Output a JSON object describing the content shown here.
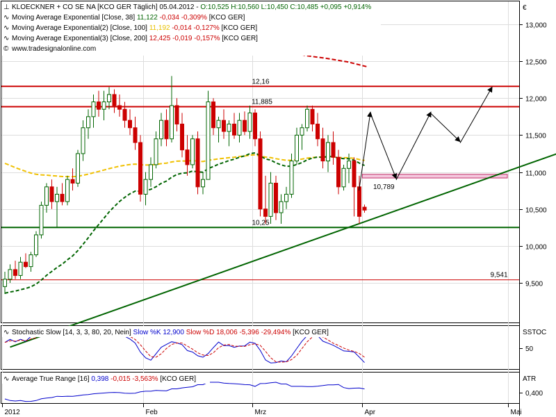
{
  "currency_symbol": "€",
  "legend": {
    "main": {
      "prefix": "KLOECKNER + CO SE NA [KCO GER  Täglich] 05.04.2012 - ",
      "ohlc": "O:10,525 H:10,560 L:10,450 C:10,485",
      "change": "+0,095 +0,914%"
    },
    "ema1": {
      "name": "Moving Average Exponential [Close, 38]",
      "value": "11,122",
      "change": "-0,034 -0,309%",
      "tail": "[KCO GER]"
    },
    "ema2": {
      "name": "Moving Average Exponential(2) [Close, 100]",
      "value": "11,192",
      "change": "-0,014 -0,127%",
      "tail": "[KCO GER]"
    },
    "ema3": {
      "name": "Moving Average Exponential(3) [Close, 200]",
      "value": "12,425",
      "change": "-0,019 -0,157%",
      "tail": "[KCO GER]"
    },
    "watermark": "www.tradesignalonline.com"
  },
  "stochastic": {
    "title": "Stochastic Slow [14, 3, 3, 80, 20, Nein]",
    "k_label": "Slow %K 12,900",
    "d_label": "Slow %D 18,006",
    "change": "-5,396 -29,494%",
    "tail": "[KCO GER]",
    "axis_label": "SSTOC",
    "tick": "50"
  },
  "atr": {
    "title": "Average True Range [16]",
    "value": "0,398",
    "change": "-0,015 -3,563%",
    "tail": "[KCO GER]",
    "axis_label": "ATR",
    "tick": "0,400"
  },
  "chart_data": {
    "type": "candlestick",
    "y_axis_ticks": [
      "13,000",
      "12,500",
      "12,000",
      "11,500",
      "11,000",
      "10,500",
      "10,000",
      "9,500"
    ],
    "x_axis_ticks": [
      "2012",
      "Feb",
      "Mrz",
      "Apr",
      "Mai"
    ],
    "ylim": [
      9.0,
      13.3
    ],
    "levels": [
      {
        "label": "12,16",
        "value": 12.16,
        "color": "#cc0000"
      },
      {
        "label": "11,885",
        "value": 11.885,
        "color": "#cc0000"
      },
      {
        "label": "10,25",
        "value": 10.25,
        "color": "#006400"
      },
      {
        "label": "9,541",
        "value": 9.541,
        "color": "#cc0000"
      }
    ],
    "annotations": [
      {
        "label": "10,789",
        "value": 10.789
      }
    ],
    "resistance_zone": [
      10.92,
      10.97
    ],
    "trendline": [
      {
        "day": 1,
        "value": 8.63
      },
      {
        "day": 120,
        "value": 11.6
      }
    ],
    "projection_path": [
      10.75,
      11.85,
      10.95,
      11.85,
      11.45,
      12.15
    ],
    "candles": [
      [
        0,
        9.45,
        9.65,
        9.35,
        9.55
      ],
      [
        1,
        9.55,
        9.75,
        9.5,
        9.68
      ],
      [
        2,
        9.68,
        9.8,
        9.55,
        9.6
      ],
      [
        3,
        9.6,
        9.85,
        9.55,
        9.78
      ],
      [
        4,
        9.78,
        9.9,
        9.7,
        9.72
      ],
      [
        5,
        9.72,
        9.92,
        9.65,
        9.88
      ],
      [
        6,
        9.88,
        10.2,
        9.85,
        10.15
      ],
      [
        7,
        10.15,
        10.6,
        10.1,
        10.55
      ],
      [
        8,
        10.55,
        10.85,
        10.45,
        10.8
      ],
      [
        9,
        10.8,
        10.9,
        10.5,
        10.6
      ],
      [
        10,
        10.6,
        10.8,
        10.25,
        10.7
      ],
      [
        11,
        10.7,
        10.85,
        10.55,
        10.6
      ],
      [
        12,
        10.6,
        10.95,
        10.55,
        10.9
      ],
      [
        13,
        10.9,
        11.05,
        10.75,
        10.85
      ],
      [
        14,
        10.85,
        11.3,
        10.8,
        11.25
      ],
      [
        15,
        11.25,
        11.7,
        11.15,
        11.6
      ],
      [
        16,
        11.6,
        11.85,
        11.45,
        11.75
      ],
      [
        17,
        11.75,
        12.05,
        11.6,
        11.95
      ],
      [
        18,
        11.95,
        12.1,
        11.75,
        11.85
      ],
      [
        19,
        11.85,
        12.1,
        11.7,
        11.95
      ],
      [
        20,
        11.95,
        12.15,
        11.85,
        12.05
      ],
      [
        21,
        12.05,
        12.12,
        11.8,
        11.9
      ],
      [
        22,
        11.9,
        12.05,
        11.75,
        11.85
      ],
      [
        23,
        11.85,
        11.95,
        11.6,
        11.7
      ],
      [
        24,
        11.7,
        11.85,
        11.5,
        11.6
      ],
      [
        25,
        11.6,
        11.75,
        11.3,
        11.4
      ],
      [
        26,
        11.4,
        11.5,
        10.6,
        10.7
      ],
      [
        27,
        10.7,
        11.0,
        10.55,
        10.9
      ],
      [
        28,
        10.9,
        11.2,
        10.8,
        11.1
      ],
      [
        29,
        11.1,
        11.55,
        11.05,
        11.45
      ],
      [
        30,
        11.45,
        11.8,
        11.35,
        11.7
      ],
      [
        31,
        11.7,
        11.85,
        11.35,
        11.45
      ],
      [
        32,
        11.45,
        12.3,
        11.4,
        11.9
      ],
      [
        33,
        11.9,
        12.0,
        11.55,
        11.65
      ],
      [
        34,
        11.65,
        11.8,
        11.2,
        11.3
      ],
      [
        35,
        11.3,
        11.5,
        10.95,
        11.1
      ],
      [
        36,
        11.1,
        11.5,
        11.05,
        11.45
      ],
      [
        37,
        11.45,
        11.55,
        10.7,
        10.8
      ],
      [
        38,
        10.8,
        11.0,
        10.7,
        10.9
      ],
      [
        39,
        10.9,
        12.1,
        10.9,
        11.95
      ],
      [
        40,
        11.95,
        12.0,
        11.5,
        11.6
      ],
      [
        41,
        11.6,
        11.75,
        11.4,
        11.7
      ],
      [
        42,
        11.7,
        11.85,
        11.45,
        11.55
      ],
      [
        43,
        11.55,
        11.7,
        11.35,
        11.65
      ],
      [
        44,
        11.65,
        11.8,
        11.45,
        11.5
      ],
      [
        45,
        11.5,
        11.8,
        11.4,
        11.7
      ],
      [
        46,
        11.7,
        11.82,
        11.5,
        11.55
      ],
      [
        47,
        11.55,
        11.9,
        11.45,
        11.8
      ],
      [
        48,
        11.8,
        11.85,
        11.35,
        11.45
      ],
      [
        49,
        11.45,
        11.55,
        10.4,
        10.5
      ],
      [
        50,
        10.5,
        10.95,
        10.3,
        10.4
      ],
      [
        51,
        10.4,
        11.0,
        10.3,
        10.85
      ],
      [
        52,
        10.85,
        10.95,
        10.35,
        10.45
      ],
      [
        53,
        10.45,
        10.7,
        10.3,
        10.6
      ],
      [
        54,
        10.6,
        10.8,
        10.5,
        10.7
      ],
      [
        55,
        10.7,
        11.25,
        10.65,
        11.15
      ],
      [
        56,
        11.15,
        11.6,
        11.1,
        11.5
      ],
      [
        57,
        11.5,
        11.65,
        11.3,
        11.6
      ],
      [
        58,
        11.6,
        11.9,
        11.55,
        11.85
      ],
      [
        59,
        11.85,
        11.9,
        11.55,
        11.65
      ],
      [
        60,
        11.65,
        11.8,
        11.35,
        11.45
      ],
      [
        61,
        11.45,
        11.6,
        11.05,
        11.15
      ],
      [
        62,
        11.15,
        11.5,
        11.0,
        11.4
      ],
      [
        63,
        11.4,
        11.55,
        11.1,
        11.2
      ],
      [
        64,
        11.2,
        11.3,
        10.7,
        10.8
      ],
      [
        65,
        10.8,
        11.1,
        10.75,
        11.05
      ],
      [
        66,
        11.05,
        11.25,
        10.85,
        11.15
      ],
      [
        67,
        11.15,
        11.2,
        10.4,
        10.8
      ],
      [
        68,
        10.8,
        10.95,
        10.3,
        10.4
      ],
      [
        69,
        10.525,
        10.56,
        10.45,
        10.485
      ]
    ]
  }
}
